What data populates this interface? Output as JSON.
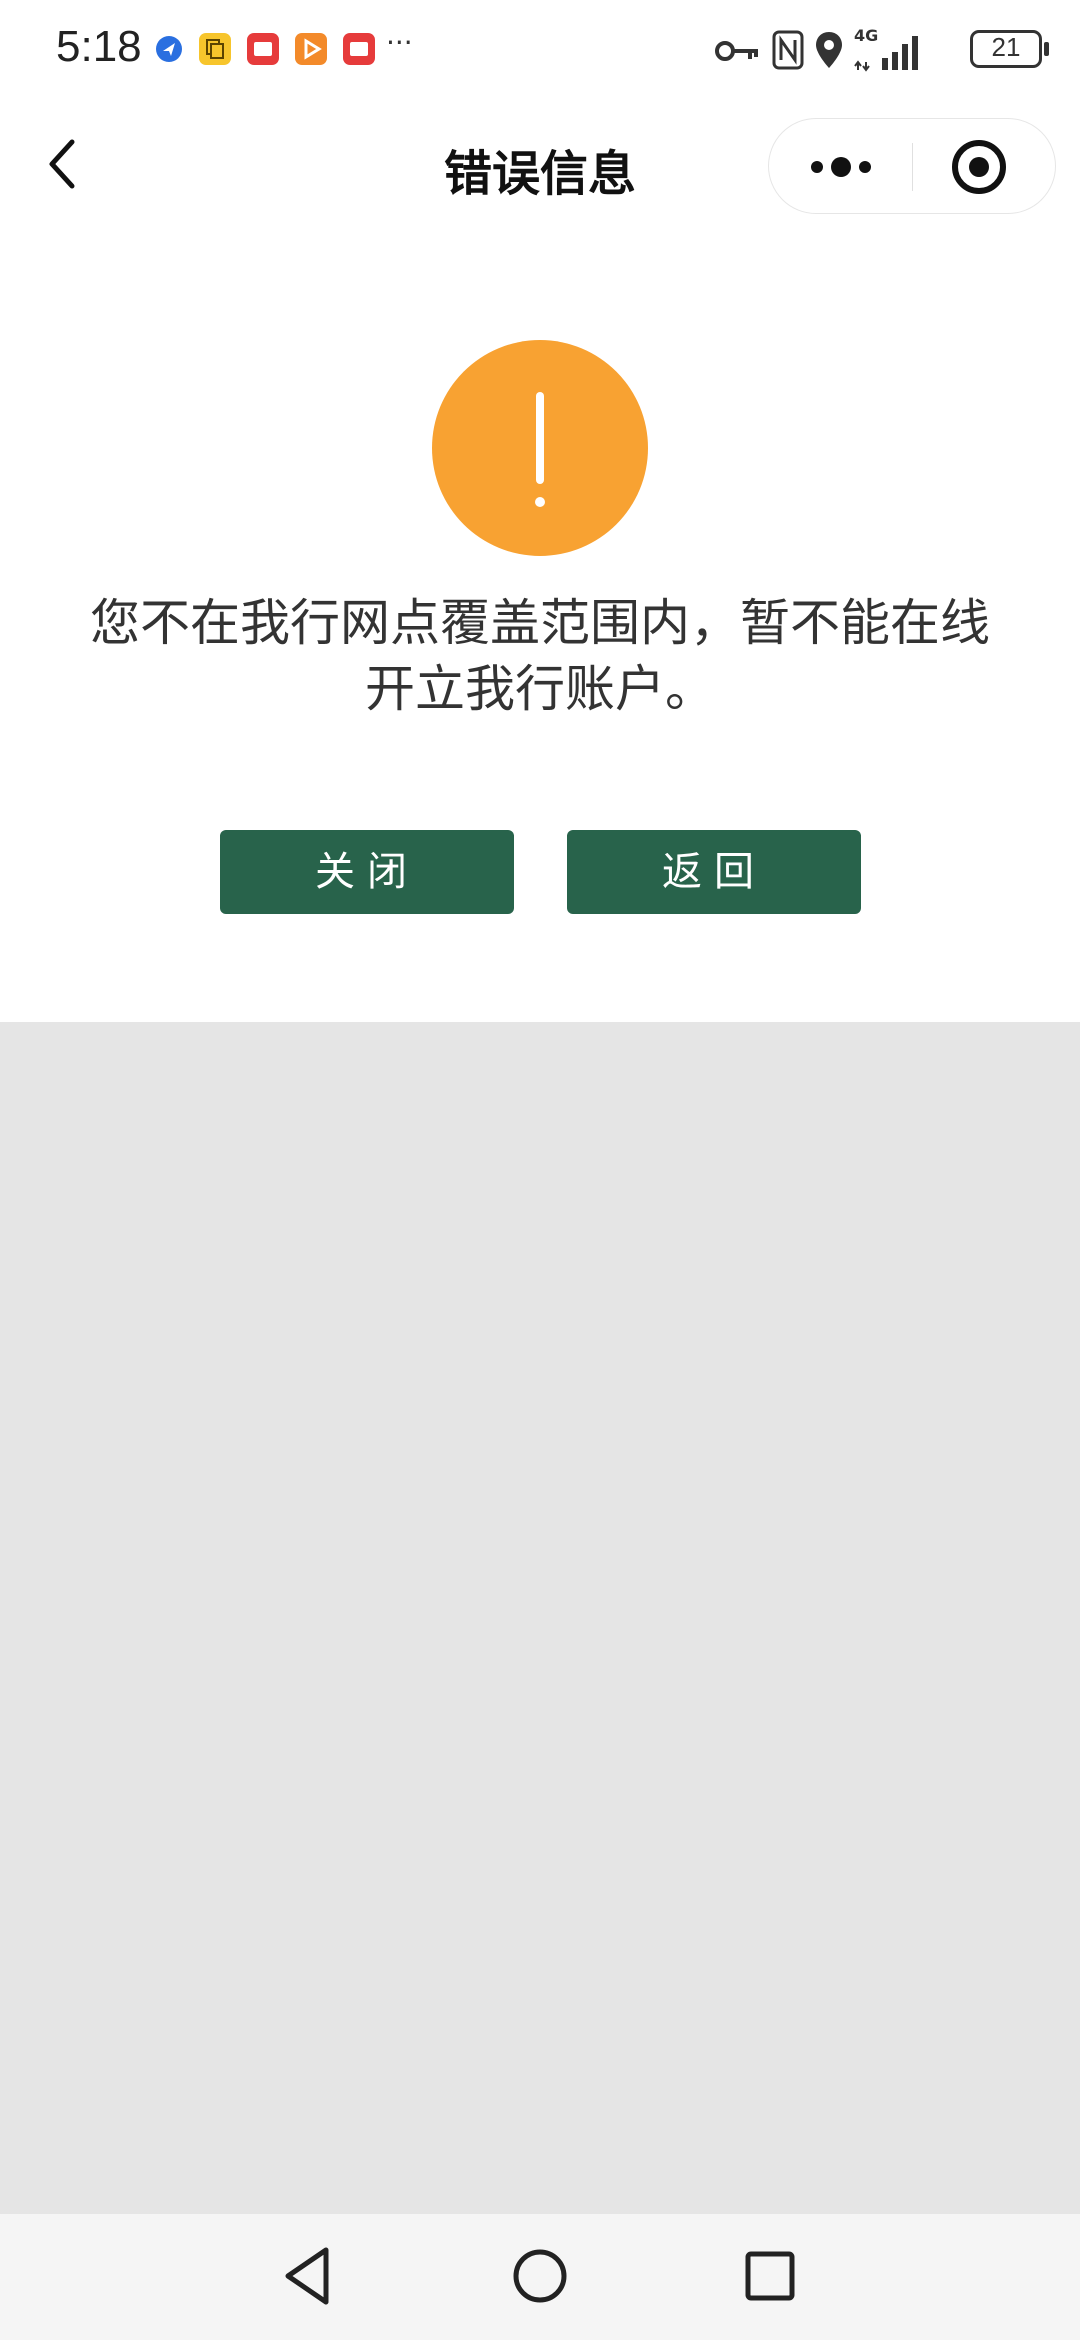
{
  "status_bar": {
    "time": "5:18",
    "more_dots": "···",
    "network": "4G",
    "battery": "21",
    "notification_icons": [
      "location-app-icon",
      "yellow-copy-icon",
      "red-app-icon",
      "orange-play-icon",
      "red-app-icon"
    ],
    "right_icons": [
      "key-icon",
      "nfc-icon",
      "location-pin-icon",
      "signal-4g-icon",
      "battery-icon"
    ]
  },
  "header": {
    "title": "错误信息"
  },
  "error": {
    "message": "您不在我行网点覆盖范围内，暂不能在线开立我行账户。",
    "icon": "warning-exclamation-icon",
    "icon_color": "#f8a232"
  },
  "buttons": {
    "close_label": "关闭",
    "back_label": "返回",
    "color": "#28634b"
  },
  "system_nav": {
    "icons": [
      "nav-back-icon",
      "nav-home-icon",
      "nav-recents-icon"
    ]
  }
}
